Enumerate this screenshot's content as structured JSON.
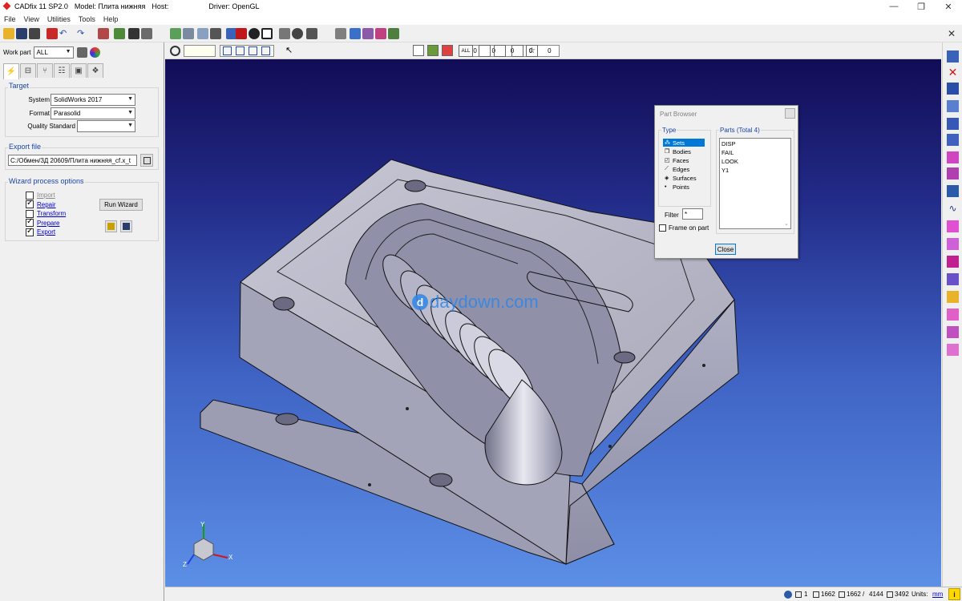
{
  "window": {
    "title_app": "CADfix 11 SP2.0",
    "title_model": "Model: Плита нижняя",
    "title_host": "Host:",
    "title_driver": "Driver: OpenGL",
    "minimize": "—",
    "restore": "❐",
    "close": "✕",
    "toolbar_close": "✕"
  },
  "menu": [
    "File",
    "View",
    "Utilities",
    "Tools",
    "Help"
  ],
  "workpart": {
    "label": "Work part",
    "value": "ALL"
  },
  "target": {
    "title": "Target",
    "system_label": "System",
    "system_value": "SolidWorks 2017",
    "format_label": "Format",
    "format_value": "Parasolid",
    "quality_label": "Quality Standard",
    "quality_value": ""
  },
  "export_file": {
    "title": "Export file",
    "path": "C:/Обмен/3Д 20609/Плита нижняя_cf.x_t"
  },
  "wizard": {
    "title": "Wizard process options",
    "run_label": "Run Wizard",
    "options": [
      {
        "label": "Import",
        "checked": false,
        "enabled": false
      },
      {
        "label": "Repair",
        "checked": true,
        "enabled": true
      },
      {
        "label": "Transform",
        "checked": false,
        "enabled": true
      },
      {
        "label": "Prepare",
        "checked": true,
        "enabled": true
      },
      {
        "label": "Export",
        "checked": true,
        "enabled": true
      }
    ]
  },
  "viewbar": {
    "counts": [
      "0",
      "0",
      "0",
      "0",
      "0"
    ],
    "all_label": "ALL"
  },
  "part_browser": {
    "title": "Part Browser",
    "type_title": "Type",
    "parts_title": "Parts (Total 4)",
    "types": [
      {
        "label": "Sets",
        "icon": "sets-icon",
        "glyph": "⁂",
        "selected": true
      },
      {
        "label": "Bodies",
        "icon": "bodies-icon",
        "glyph": "❒",
        "selected": false
      },
      {
        "label": "Faces",
        "icon": "faces-icon",
        "glyph": "◰",
        "selected": false
      },
      {
        "label": "Edges",
        "icon": "edges-icon",
        "glyph": "⟋",
        "selected": false
      },
      {
        "label": "Surfaces",
        "icon": "surfaces-icon",
        "glyph": "◈",
        "selected": false
      },
      {
        "label": "Points",
        "icon": "points-icon",
        "glyph": "•",
        "selected": false
      }
    ],
    "parts": [
      "DISP",
      "FAIL",
      "LOOK",
      "Y1"
    ],
    "filter_label": "Filter",
    "filter_value": "*",
    "frame_label": "Frame on part",
    "close_label": "Close"
  },
  "watermark": {
    "glyph": "d",
    "text": "daydown.com"
  },
  "axes": {
    "x": "X",
    "y": "Y",
    "z": "Z"
  },
  "status": {
    "a": "1",
    "b": "1662",
    "c": "1662",
    "d": "4144",
    "e": "3492",
    "units_label": "Units:",
    "units_value": "mm",
    "info": "i"
  }
}
